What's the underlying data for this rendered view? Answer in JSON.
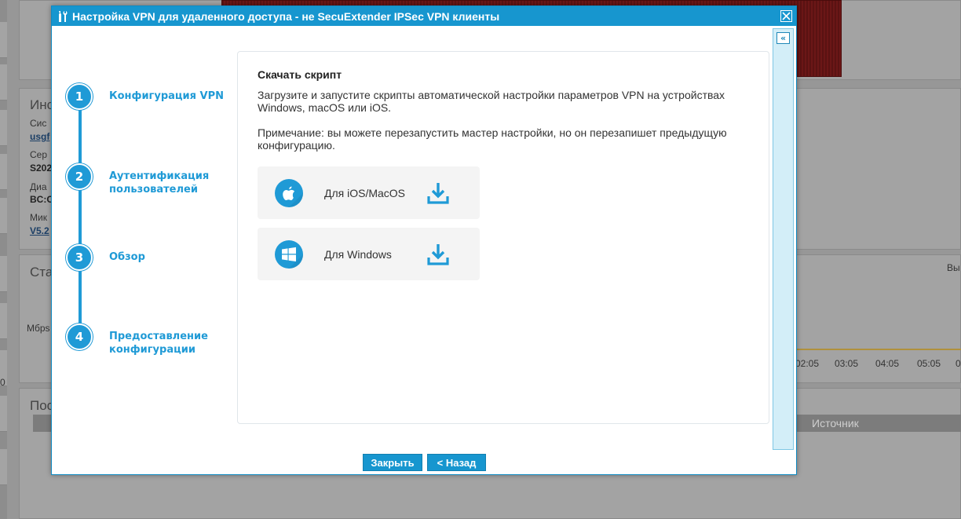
{
  "background": {
    "texts": {
      "info_heading": "Инс",
      "sys_label": "Сис",
      "sys_link": "usgf",
      "serial_label": "Сер",
      "serial_value": "S202",
      "range_label": "Диа",
      "range_value": "BC:C",
      "micro_label": "Мик",
      "micro_link": "V5.2",
      "stats_heading": "Ста",
      "mbps_label": "Мбрs",
      "bottom_heading": "Пос",
      "right_label": "Вы",
      "zero_label": "0",
      "table_source_header": "Источник"
    },
    "time_ticks": [
      "02:05",
      "03:05",
      "04:05",
      "05:05",
      "0"
    ]
  },
  "dialog": {
    "title": "Настройка VPN для удаленного доступа - не SecuExtender IPSec VPN клиенты",
    "steps": [
      {
        "number": "1",
        "label": "Конфигурация VPN"
      },
      {
        "number": "2",
        "label": "Аутентификация пользователей"
      },
      {
        "number": "3",
        "label": "Обзор"
      },
      {
        "number": "4",
        "label": "Предоставление конфигурации"
      }
    ],
    "content": {
      "heading": "Скачать скрипт",
      "description": "Загрузите и запустите скрипты автоматической настройки параметров VPN на устройствах Windows, macOS или iOS.",
      "note": "Примечание: вы можете перезапустить мастер настройки, но он перезапишет предыдущую конфигурацию.",
      "downloads": [
        {
          "label": "Для iOS/MacOS",
          "icon": "apple-icon"
        },
        {
          "label": "Для Windows",
          "icon": "windows-icon"
        }
      ]
    },
    "buttons": {
      "close": "Закрыть",
      "back": "< Назад"
    }
  },
  "colors": {
    "accent": "#1796cf",
    "step_blue": "#1f9ad6",
    "overlay_gray": "#979797"
  }
}
